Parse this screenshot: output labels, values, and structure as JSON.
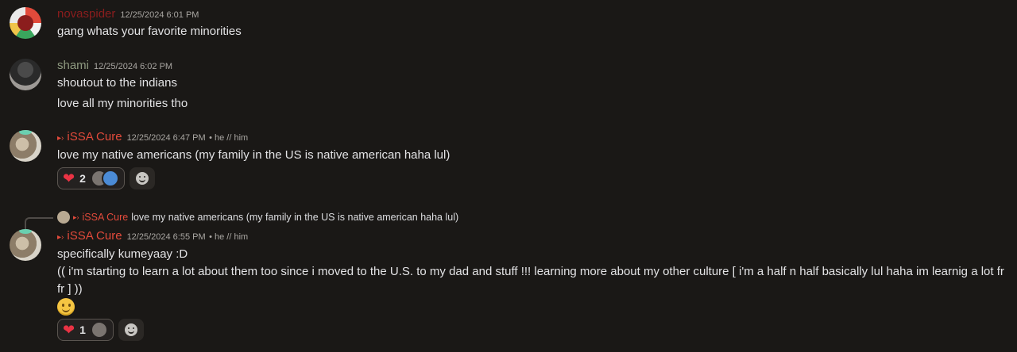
{
  "colors": {
    "background": "#1a1816",
    "novaspider": "#8b1d1d",
    "shami": "#8f9a80",
    "issa": "#e24a3b",
    "heart": "#ea3344"
  },
  "messages": [
    {
      "username": "novaspider",
      "timestamp": "12/25/2024 6:01 PM",
      "lines": [
        "gang whats your favorite minorities"
      ]
    },
    {
      "username": "shami",
      "timestamp": "12/25/2024 6:02 PM",
      "lines": [
        "shoutout to the indians",
        "love all my minorities tho"
      ]
    },
    {
      "username": "iSSA Cure",
      "role_arrows": "▸›",
      "timestamp": "12/25/2024 6:47 PM",
      "pronouns": "• he // him",
      "lines": [
        "love my native americans (my family in the US is native american haha lul)"
      ],
      "reaction": {
        "emoji": "heart",
        "glyph": "❤",
        "count": "2"
      }
    },
    {
      "reply_to": {
        "username": "iSSA Cure",
        "role_arrows": "▸›",
        "text": "love my native americans (my family in the US is native american haha lul)"
      },
      "username": "iSSA Cure",
      "role_arrows": "▸›",
      "timestamp": "12/25/2024 6:55 PM",
      "pronouns": "• he // him",
      "lines": [
        "specifically kumeyaay :D",
        "(( i'm starting to learn a lot about them too since i moved to the U.S. to my dad and stuff !!!  learning more about my other culture  [ i'm a half n half basically lul haha im learnig a lot fr fr ] ))"
      ],
      "emoji": "slightly-smiling-face",
      "reaction": {
        "emoji": "heart",
        "glyph": "❤",
        "count": "1"
      }
    }
  ]
}
